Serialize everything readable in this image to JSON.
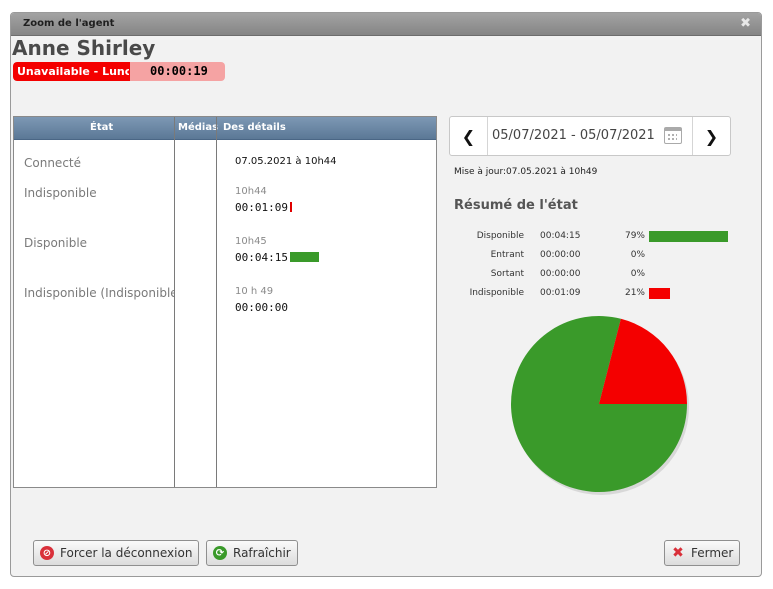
{
  "window": {
    "title": "Zoom de l'agent",
    "close_icon": "close-icon"
  },
  "agent": {
    "name": "Anne Shirley",
    "status_label": "Unavailable - Lunch",
    "status_timer": "00:00:19",
    "status_color": "#f40000"
  },
  "grid": {
    "columns": [
      "État",
      "Médias",
      "Des détails"
    ],
    "rows": [
      {
        "state": "Connecté",
        "time": "07.05.2021 à 10h44",
        "duration": ""
      },
      {
        "state": "Indisponible",
        "time": "10h44",
        "duration": "00:01:09",
        "bar_color": "#e00000",
        "share": 0.21
      },
      {
        "state": "Disponible",
        "time": "10h45",
        "duration": "00:04:15",
        "bar_color": "#3a9a2a",
        "share": 0.79
      },
      {
        "state": "Indisponible (Indisponible)",
        "time": "10 h 49",
        "duration": "00:00:00",
        "share": 0.0
      }
    ]
  },
  "date_range": {
    "value": "05/07/2021 - 05/07/2021",
    "prev_icon": "chevron-left-icon",
    "next_icon": "chevron-right-icon",
    "calendar_icon": "calendar-icon"
  },
  "updated": "Mise à jour:07.05.2021 à 10h49",
  "summary": {
    "title": "Résumé de l'état",
    "rows": [
      {
        "label": "Disponible",
        "duration": "00:04:15",
        "percent": "79%",
        "share": 0.79,
        "color": "#3a9a2a"
      },
      {
        "label": "Entrant",
        "duration": "00:00:00",
        "percent": "0%",
        "share": 0.0,
        "color": "#3a9a2a"
      },
      {
        "label": "Sortant",
        "duration": "00:00:00",
        "percent": "0%",
        "share": 0.0,
        "color": "#3a9a2a"
      },
      {
        "label": "Indisponible",
        "duration": "00:01:09",
        "percent": "21%",
        "share": 0.21,
        "color": "#f40000"
      }
    ]
  },
  "chart_data": {
    "type": "pie",
    "categories": [
      "Disponible",
      "Indisponible"
    ],
    "values": [
      79,
      21
    ],
    "colors": [
      "#3a9a2a",
      "#f40000"
    ]
  },
  "buttons": {
    "disconnect": "Forcer la déconnexion",
    "refresh": "Rafraîchir",
    "close": "Fermer"
  }
}
